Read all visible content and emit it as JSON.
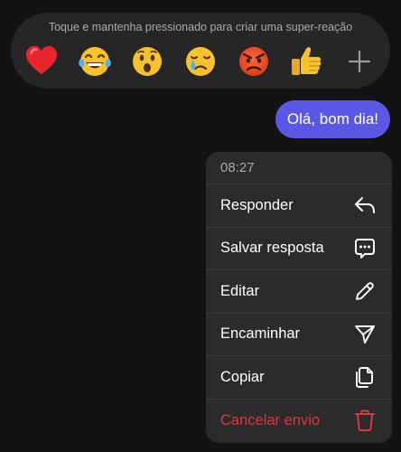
{
  "reactions": {
    "hint": "Toque e mantenha pressionado para criar uma super-reação",
    "items": [
      {
        "icon": "red-heart-emoji"
      },
      {
        "icon": "tears-of-joy-emoji"
      },
      {
        "icon": "surprised-face-emoji"
      },
      {
        "icon": "crying-face-emoji"
      },
      {
        "icon": "angry-face-emoji"
      },
      {
        "icon": "thumbs-up-emoji"
      },
      {
        "icon": "plus-icon"
      }
    ]
  },
  "message": {
    "text": "Olá, bom dia!",
    "bubble_color": "#5b57e6"
  },
  "menu": {
    "time": "08:27",
    "items": [
      {
        "label": "Responder",
        "icon": "reply-icon"
      },
      {
        "label": "Salvar resposta",
        "icon": "chat-bubble-dots-icon"
      },
      {
        "label": "Editar",
        "icon": "pencil-icon"
      },
      {
        "label": "Encaminhar",
        "icon": "send-icon"
      },
      {
        "label": "Copiar",
        "icon": "copy-icon"
      },
      {
        "label": "Cancelar envio",
        "icon": "trash-icon",
        "danger": true
      }
    ],
    "danger_color": "#e0353f"
  }
}
